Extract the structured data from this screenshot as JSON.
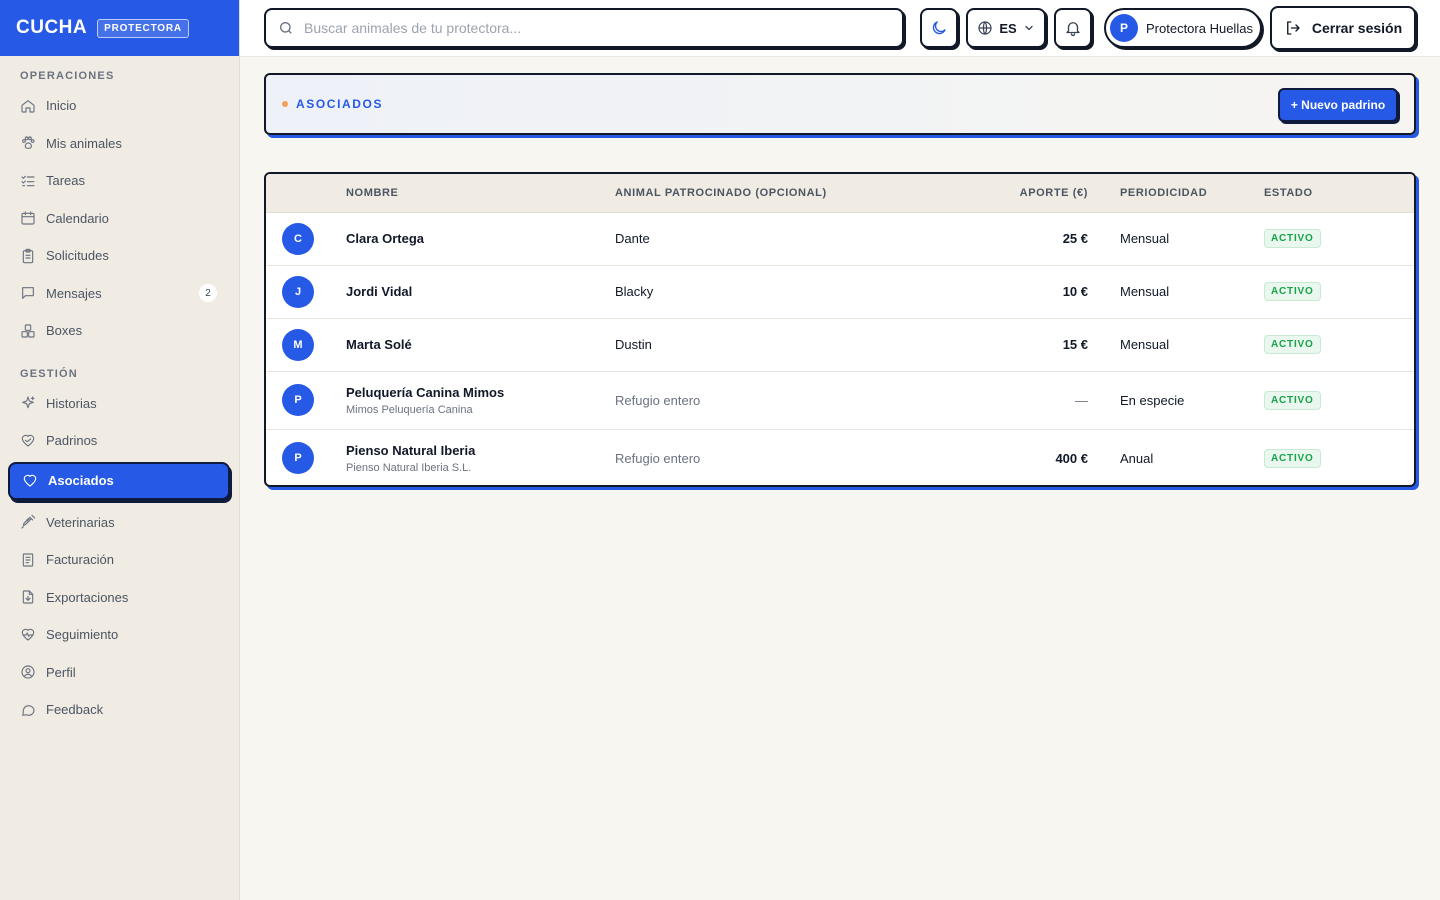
{
  "brand": {
    "name": "CUCHA",
    "badge": "PROTECTORA"
  },
  "sidebar": {
    "sections": [
      {
        "title": "OPERACIONES",
        "items": [
          {
            "label": "Inicio",
            "icon": "home-icon"
          },
          {
            "label": "Mis animales",
            "icon": "paw-icon"
          },
          {
            "label": "Tareas",
            "icon": "checklist-icon"
          },
          {
            "label": "Calendario",
            "icon": "calendar-icon"
          },
          {
            "label": "Solicitudes",
            "icon": "clipboard-icon"
          },
          {
            "label": "Mensajes",
            "icon": "message-icon",
            "count": "2"
          },
          {
            "label": "Boxes",
            "icon": "boxes-icon"
          }
        ]
      },
      {
        "title": "GESTIÓN",
        "items": [
          {
            "label": "Historias",
            "icon": "sparkles-icon"
          },
          {
            "label": "Padrinos",
            "icon": "heart-handshake-icon"
          },
          {
            "label": "Asociados",
            "icon": "heart-icon",
            "active": true
          },
          {
            "label": "Veterinarias",
            "icon": "syringe-icon"
          },
          {
            "label": "Facturación",
            "icon": "receipt-icon"
          },
          {
            "label": "Exportaciones",
            "icon": "file-download-icon"
          },
          {
            "label": "Seguimiento",
            "icon": "heart-pulse-icon"
          },
          {
            "label": "Perfil",
            "icon": "user-circle-icon"
          },
          {
            "label": "Feedback",
            "icon": "chat-bubble-icon"
          }
        ]
      }
    ]
  },
  "topbar": {
    "search_placeholder": "Buscar animales de tu protectora...",
    "language": "ES",
    "user_initial": "P",
    "user_name": "Protectora Huellas",
    "logout_label": "Cerrar sesión"
  },
  "header": {
    "title": "ASOCIADOS",
    "new_button": "+ Nuevo padrino"
  },
  "table": {
    "columns": [
      "",
      "NOMBRE",
      "ANIMAL PATROCINADO (OPCIONAL)",
      "APORTE (€)",
      "PERIODICIDAD",
      "ESTADO"
    ],
    "rows": [
      {
        "initial": "C",
        "name": "Clara Ortega",
        "sub": "",
        "animal": "Dante",
        "amount": "25 €",
        "period": "Mensual",
        "status": "ACTIVO"
      },
      {
        "initial": "J",
        "name": "Jordi Vidal",
        "sub": "",
        "animal": "Blacky",
        "amount": "10 €",
        "period": "Mensual",
        "status": "ACTIVO"
      },
      {
        "initial": "M",
        "name": "Marta Solé",
        "sub": "",
        "animal": "Dustin",
        "amount": "15 €",
        "period": "Mensual",
        "status": "ACTIVO"
      },
      {
        "initial": "P",
        "name": "Peluquería Canina Mimos",
        "sub": "Mimos Peluquería Canina",
        "animal": "Refugio entero",
        "amount": "—",
        "period": "En especie",
        "status": "ACTIVO"
      },
      {
        "initial": "P",
        "name": "Pienso Natural Iberia",
        "sub": "Pienso Natural Iberia S.L.",
        "animal": "Refugio entero",
        "amount": "400 €",
        "period": "Anual",
        "status": "ACTIVO"
      }
    ]
  },
  "colors": {
    "accent": "#2559e6",
    "status_active": "#16a34a",
    "sidebar_bg": "#f0ece3"
  }
}
